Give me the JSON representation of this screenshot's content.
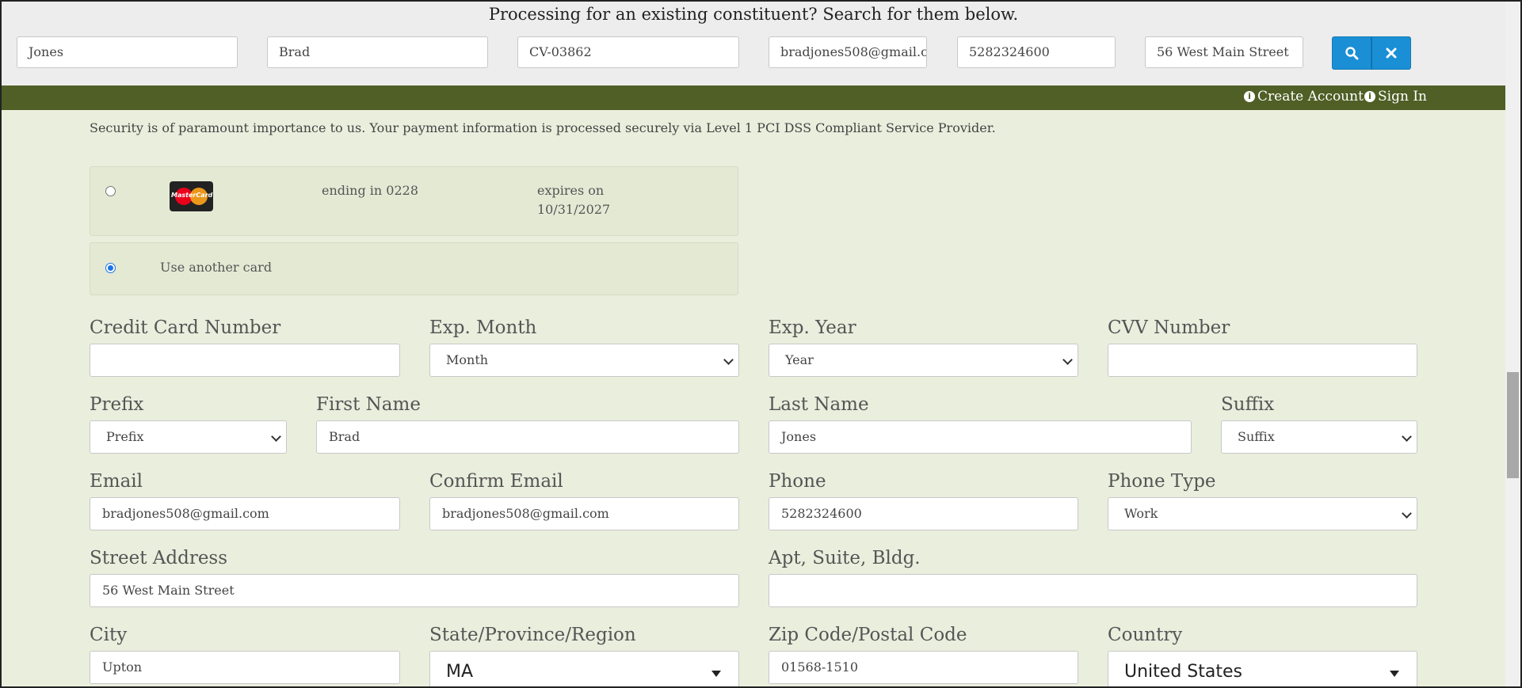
{
  "search": {
    "title": "Processing for an existing constituent? Search for them below.",
    "fields": [
      "Jones",
      "Brad",
      "CV-03862",
      "bradjones508@gmail.com",
      "5282324600",
      "56 West Main Street"
    ],
    "search_icon": "search-icon",
    "clear_icon": "close-icon",
    "button_color": "#1a8fd6"
  },
  "account_bar": {
    "create_account": "Create Account",
    "sign_in": "Sign In",
    "bar_color": "#4f5f25"
  },
  "security": {
    "text": "Security is of paramount importance to us. Your payment information is processed securely via Level 1 PCI DSS Compliant Service Provider."
  },
  "saved_card": {
    "brand": "MasterCard",
    "ending": "ending in 0228",
    "expires_label": "expires on",
    "expires_date": "10/31/2027",
    "selected": false
  },
  "another_card": {
    "label": "Use another card",
    "selected": true
  },
  "form": {
    "credit_card_number": {
      "label": "Credit Card Number",
      "value": ""
    },
    "exp_month": {
      "label": "Exp. Month",
      "value": "Month"
    },
    "exp_year": {
      "label": "Exp. Year",
      "value": "Year"
    },
    "cvv": {
      "label": "CVV Number",
      "value": ""
    },
    "prefix": {
      "label": "Prefix",
      "value": "Prefix"
    },
    "first_name": {
      "label": "First Name",
      "value": "Brad"
    },
    "last_name": {
      "label": "Last Name",
      "value": "Jones"
    },
    "suffix": {
      "label": "Suffix",
      "value": "Suffix"
    },
    "email": {
      "label": "Email",
      "value": "bradjones508@gmail.com"
    },
    "confirm_email": {
      "label": "Confirm Email",
      "value": "bradjones508@gmail.com"
    },
    "phone": {
      "label": "Phone",
      "value": "5282324600"
    },
    "phone_type": {
      "label": "Phone Type",
      "value": "Work"
    },
    "street": {
      "label": "Street Address",
      "value": "56 West Main Street"
    },
    "apt": {
      "label": "Apt, Suite, Bldg.",
      "value": ""
    },
    "city": {
      "label": "City",
      "value": "Upton"
    },
    "state": {
      "label": "State/Province/Region",
      "value": "MA"
    },
    "zip": {
      "label": "Zip Code/Postal Code",
      "value": "01568-1510"
    },
    "country": {
      "label": "Country",
      "value": "United States"
    }
  }
}
